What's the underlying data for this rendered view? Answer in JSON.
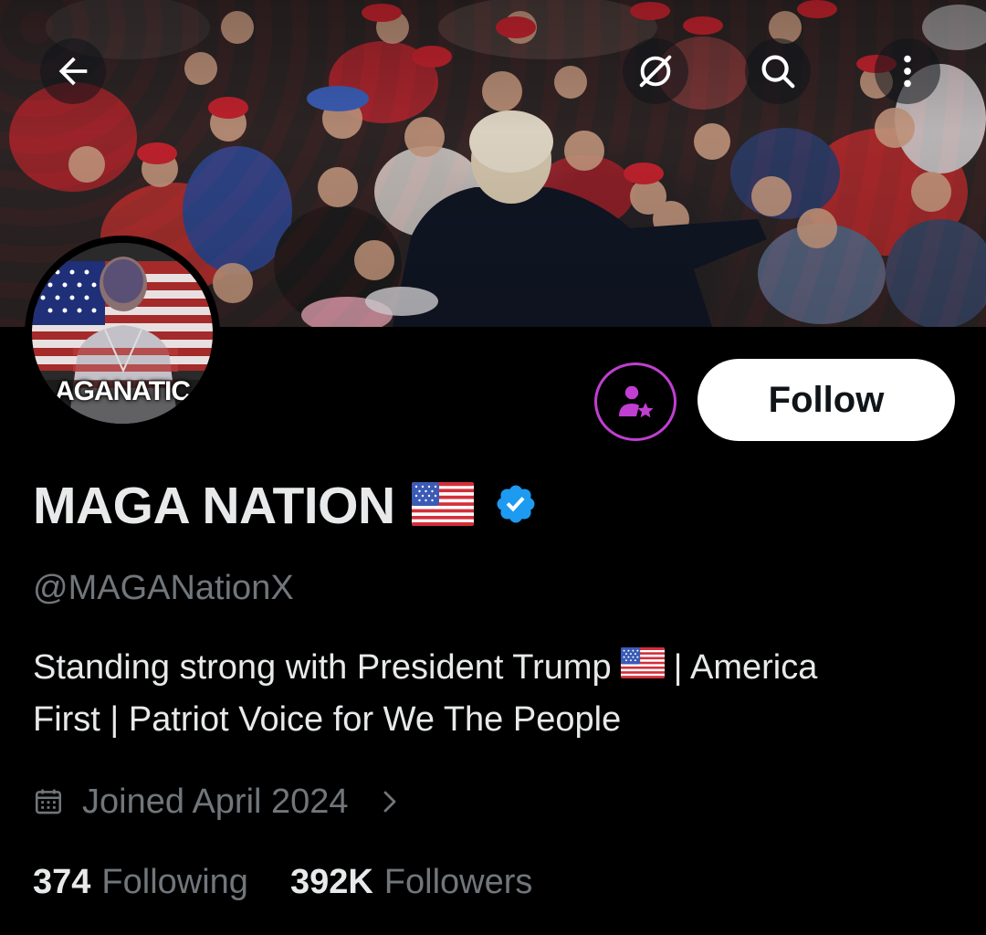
{
  "profile": {
    "display_name": "MAGA NATION",
    "handle": "@MAGANationX",
    "bio_line1_before": "Standing strong with President Trump",
    "bio_line1_after": "| America",
    "bio_line2": "First | Patriot Voice for We The People",
    "joined": "Joined April 2024",
    "following_count": "374",
    "following_label": "Following",
    "followers_count": "392K",
    "followers_label": "Followers",
    "avatar_text": "AGANATIC"
  },
  "actions": {
    "follow_label": "Follow"
  },
  "icons": {
    "back": "arrow-left-icon",
    "grok": "grok-slash-circle-icon",
    "search": "search-icon",
    "more": "more-vertical-icon",
    "subscribe": "person-star-icon",
    "verified": "verified-badge-icon",
    "calendar": "calendar-icon",
    "chevron": "chevron-right-icon"
  },
  "colors": {
    "background": "#000000",
    "text_primary": "#e7e9ea",
    "text_secondary": "#71767b",
    "verified_blue": "#1d9bf0",
    "subscribe_purple": "#c03fd1",
    "follow_bg": "#ffffff"
  }
}
